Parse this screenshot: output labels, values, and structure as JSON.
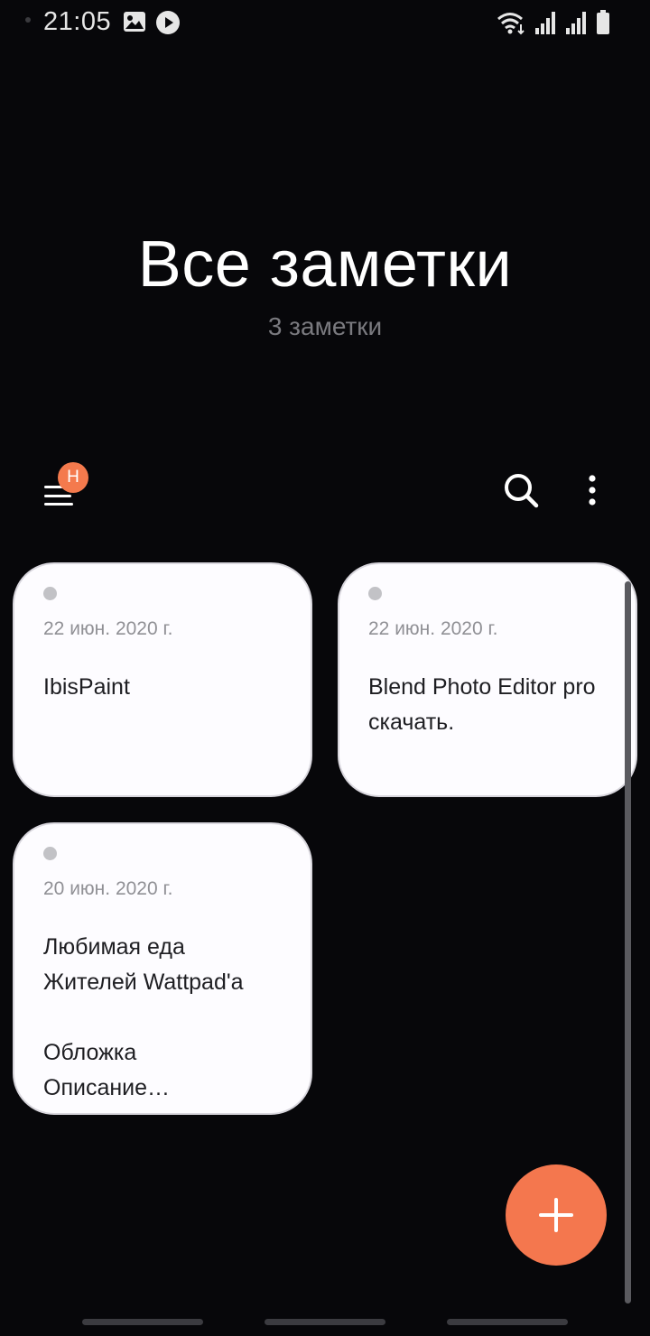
{
  "status_bar": {
    "time": "21:05",
    "left_icons": [
      "gallery-icon",
      "play-icon"
    ],
    "right_icons": [
      "wifi-icon",
      "signal-icon",
      "signal-icon",
      "battery-icon"
    ]
  },
  "header": {
    "title": "Все заметки",
    "subtitle": "3 заметки"
  },
  "toolbar": {
    "menu_badge": "Н",
    "menu_icon": "hamburger-icon",
    "search_icon": "search-icon",
    "more_icon": "more-vertical-icon"
  },
  "notes": [
    {
      "date": "22 июн. 2020 г.",
      "lines": [
        "IbisPaint"
      ]
    },
    {
      "date": "22 июн. 2020 г.",
      "lines": [
        "Blend Photo Editor pro",
        "скачать."
      ]
    },
    {
      "date": "20 июн. 2020 г.",
      "lines": [
        "Любимая еда",
        "Жителей Wattpad'a",
        "",
        "Обложка",
        "Описание…"
      ]
    }
  ],
  "fab": {
    "icon": "plus-icon"
  },
  "colors": {
    "background": "#07070a",
    "card": "#fdfcff",
    "accent": "#f4774e",
    "muted_text": "#7a7a7f"
  }
}
